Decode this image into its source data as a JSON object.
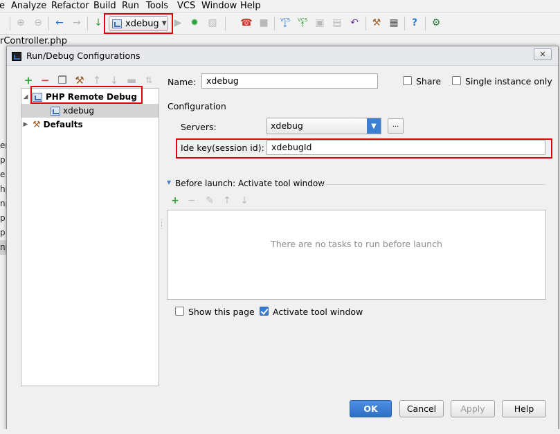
{
  "menubar": {
    "items": [
      "Analyze",
      "Refactor",
      "Build",
      "Run",
      "Tools",
      "VCS",
      "Window",
      "Help"
    ]
  },
  "toolbar": {
    "run_config": "xdebug",
    "vcs_label_1": "VCS",
    "vcs_label_2": "VCS"
  },
  "editor": {
    "file_tab": "rController.php",
    "gutter_chars": [
      "er.",
      "p",
      "e.p",
      "hp",
      "np",
      "p",
      "p",
      "np"
    ]
  },
  "dialog": {
    "title": "Run/Debug Configurations",
    "tree": {
      "group": "PHP Remote Debug",
      "child": "xdebug",
      "defaults": "Defaults"
    },
    "name_label": "Name:",
    "name_value": "xdebug",
    "share_label": "Share",
    "single_instance_label": "Single instance only",
    "configuration_section": "Configuration",
    "servers_label": "Servers:",
    "servers_value": "xdebug",
    "servers_more": "...",
    "idekey_label": "Ide key(session id):",
    "idekey_value": "xdebugId",
    "before_launch_label": "Before launch: Activate tool window",
    "tasks_empty": "There are no tasks to run before launch",
    "show_page_label": "Show this page",
    "show_page_checked": false,
    "activate_tool_label": "Activate tool window",
    "activate_tool_checked": true,
    "share_checked": false,
    "single_instance_checked": false,
    "buttons": {
      "ok": "OK",
      "cancel": "Cancel",
      "apply": "Apply",
      "help": "Help"
    }
  },
  "colors": {
    "highlight_box": "#e0000c",
    "primary_button": "#3a7bd5",
    "checkbox_checked": "#3b7bd4"
  }
}
